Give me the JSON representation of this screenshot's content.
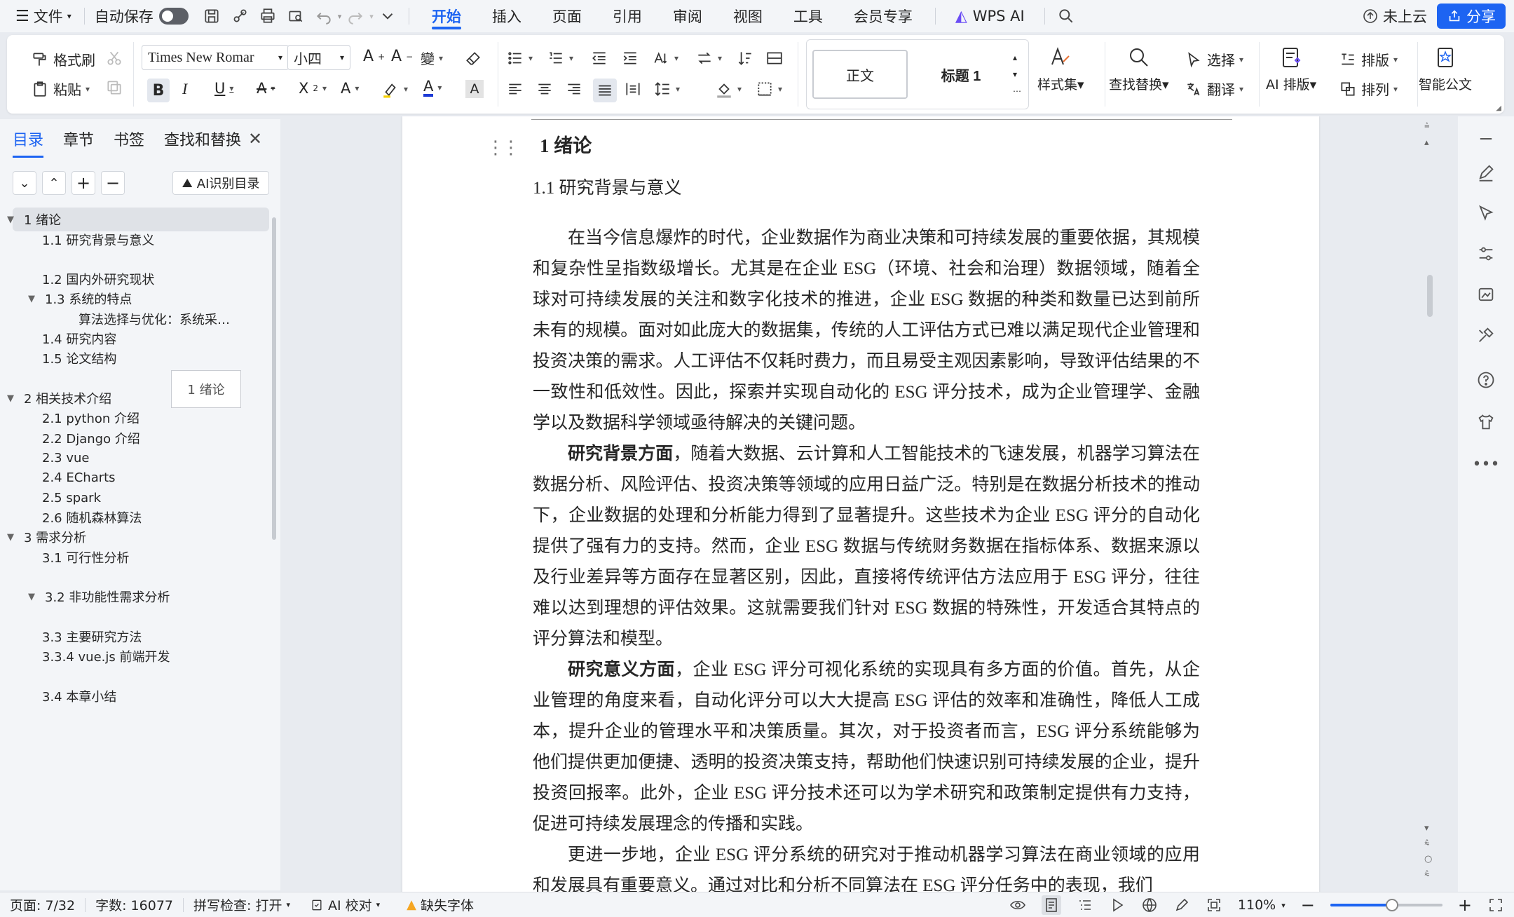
{
  "menubar": {
    "file_label": "文件",
    "autosave_label": "自动保存",
    "tabs": [
      "开始",
      "插入",
      "页面",
      "引用",
      "审阅",
      "视图",
      "工具",
      "会员专享"
    ],
    "active_tab": "开始",
    "wps_ai_label": "WPS AI",
    "cloud_status": "未上云",
    "share_label": "分享"
  },
  "ribbon": {
    "format_painter": "格式刷",
    "paste": "粘贴",
    "font_name": "Times New Romar",
    "font_size": "小四",
    "style_normal": "正文",
    "style_heading1": "标题 1",
    "style_set": "样式集",
    "find_replace": "查找替换",
    "select": "选择",
    "translate": "翻译",
    "ai_layout": "AI 排版",
    "layout": "排版",
    "arrange": "排列",
    "smart_doc": "智能公文"
  },
  "nav": {
    "tabs": [
      "目录",
      "章节",
      "书签",
      "查找和替换"
    ],
    "active_tab": "目录",
    "ai_toc_label": "AI识别目录",
    "tooltip": "1 绪论",
    "toc": [
      {
        "label": "1  绪论",
        "level": 1,
        "arrow": true,
        "selected": true
      },
      {
        "label": "1.1 研究背景与意义",
        "level": 2,
        "arrow": false,
        "selected": false
      },
      {
        "label": "1.2 国内外研究现状",
        "level": 2,
        "arrow": false,
        "selected": false
      },
      {
        "label": "1.3 系统的特点",
        "level": 2,
        "arrow": true,
        "selected": false
      },
      {
        "label": "算法选择与优化：系统采…",
        "level": 3,
        "arrow": false,
        "selected": false
      },
      {
        "label": "1.4 研究内容",
        "level": 2,
        "arrow": false,
        "selected": false
      },
      {
        "label": "1.5 论文结构",
        "level": 2,
        "arrow": false,
        "selected": false
      },
      {
        "label": "2  相关技术介绍",
        "level": 1,
        "arrow": true,
        "selected": false
      },
      {
        "label": "2.1 python 介绍",
        "level": 2,
        "arrow": false,
        "selected": false
      },
      {
        "label": "2.2 Django  介绍",
        "level": 2,
        "arrow": false,
        "selected": false
      },
      {
        "label": "2.3 vue",
        "level": 2,
        "arrow": false,
        "selected": false
      },
      {
        "label": "2.4 ECharts",
        "level": 2,
        "arrow": false,
        "selected": false
      },
      {
        "label": "2.5 spark",
        "level": 2,
        "arrow": false,
        "selected": false
      },
      {
        "label": "2.6  随机森林算法",
        "level": 2,
        "arrow": false,
        "selected": false
      },
      {
        "label": "3  需求分析",
        "level": 1,
        "arrow": true,
        "selected": false
      },
      {
        "label": "3.1 可行性分析",
        "level": 2,
        "arrow": false,
        "selected": false
      },
      {
        "label": "3.2  非功能性需求分析",
        "level": 2,
        "arrow": true,
        "selected": false
      },
      {
        "label": "3.3 主要研究方法",
        "level": 2,
        "arrow": false,
        "selected": false
      },
      {
        "label": "3.3.4 vue.js 前端开发",
        "level": 2,
        "arrow": false,
        "selected": false
      },
      {
        "label": "3.4 本章小结",
        "level": 2,
        "arrow": false,
        "selected": false
      }
    ]
  },
  "document": {
    "heading1": "1  绪论",
    "heading2": "1.1 研究背景与意义",
    "para1": "在当今信息爆炸的时代，企业数据作为商业决策和可持续发展的重要依据，其规模和复杂性呈指数级增长。尤其是在企业 ESG（环境、社会和治理）数据领域，随着全球对可持续发展的关注和数字化技术的推进，企业 ESG 数据的种类和数量已达到前所未有的规模。面对如此庞大的数据集，传统的人工评估方式已难以满足现代企业管理和投资决策的需求。人工评估不仅耗时费力，而且易受主观因素影响，导致评估结果的不一致性和低效性。因此，探索并实现自动化的 ESG 评分技术，成为企业管理学、金融学以及数据科学领域亟待解决的关键问题。",
    "para2_bold": "研究背景方面",
    "para2": "，随着大数据、云计算和人工智能技术的飞速发展，机器学习算法在数据分析、风险评估、投资决策等领域的应用日益广泛。特别是在数据分析技术的推动下，企业数据的处理和分析能力得到了显著提升。这些技术为企业 ESG 评分的自动化提供了强有力的支持。然而，企业 ESG 数据与传统财务数据在指标体系、数据来源以及行业差异等方面存在显著区别，因此，直接将传统评估方法应用于 ESG 评分，往往难以达到理想的评估效果。这就需要我们针对 ESG 数据的特殊性，开发适合其特点的评分算法和模型。",
    "para3_bold": "研究意义方面",
    "para3": "，企业 ESG 评分可视化系统的实现具有多方面的价值。首先，从企业管理的角度来看，自动化评分可以大大提高 ESG 评估的效率和准确性，降低人工成本，提升企业的管理水平和决策质量。其次，对于投资者而言，ESG 评分系统能够为他们提供更加便捷、透明的投资决策支持，帮助他们快速识别可持续发展的企业，提升投资回报率。此外，企业 ESG 评分技术还可以为学术研究和政策制定提供有力支持，促进可持续发展理念的传播和实践。",
    "para4": "更进一步地，企业 ESG 评分系统的研究对于推动机器学习算法在商业领域的应用和发展具有重要意义。通过对比和分析不同算法在 ESG 评分任务中的表现，我们"
  },
  "status": {
    "page": "页面: 7/32",
    "words": "字数: 16077",
    "spellcheck": "拼写检查: 打开",
    "ai_proof": "AI 校对",
    "missing_font": "缺失字体",
    "zoom": "110%",
    "zoom_fraction": 0.55
  },
  "colors": {
    "accent": "#1d64f2",
    "ai_purple": "#6a4cf5",
    "warning": "#f5a623"
  }
}
